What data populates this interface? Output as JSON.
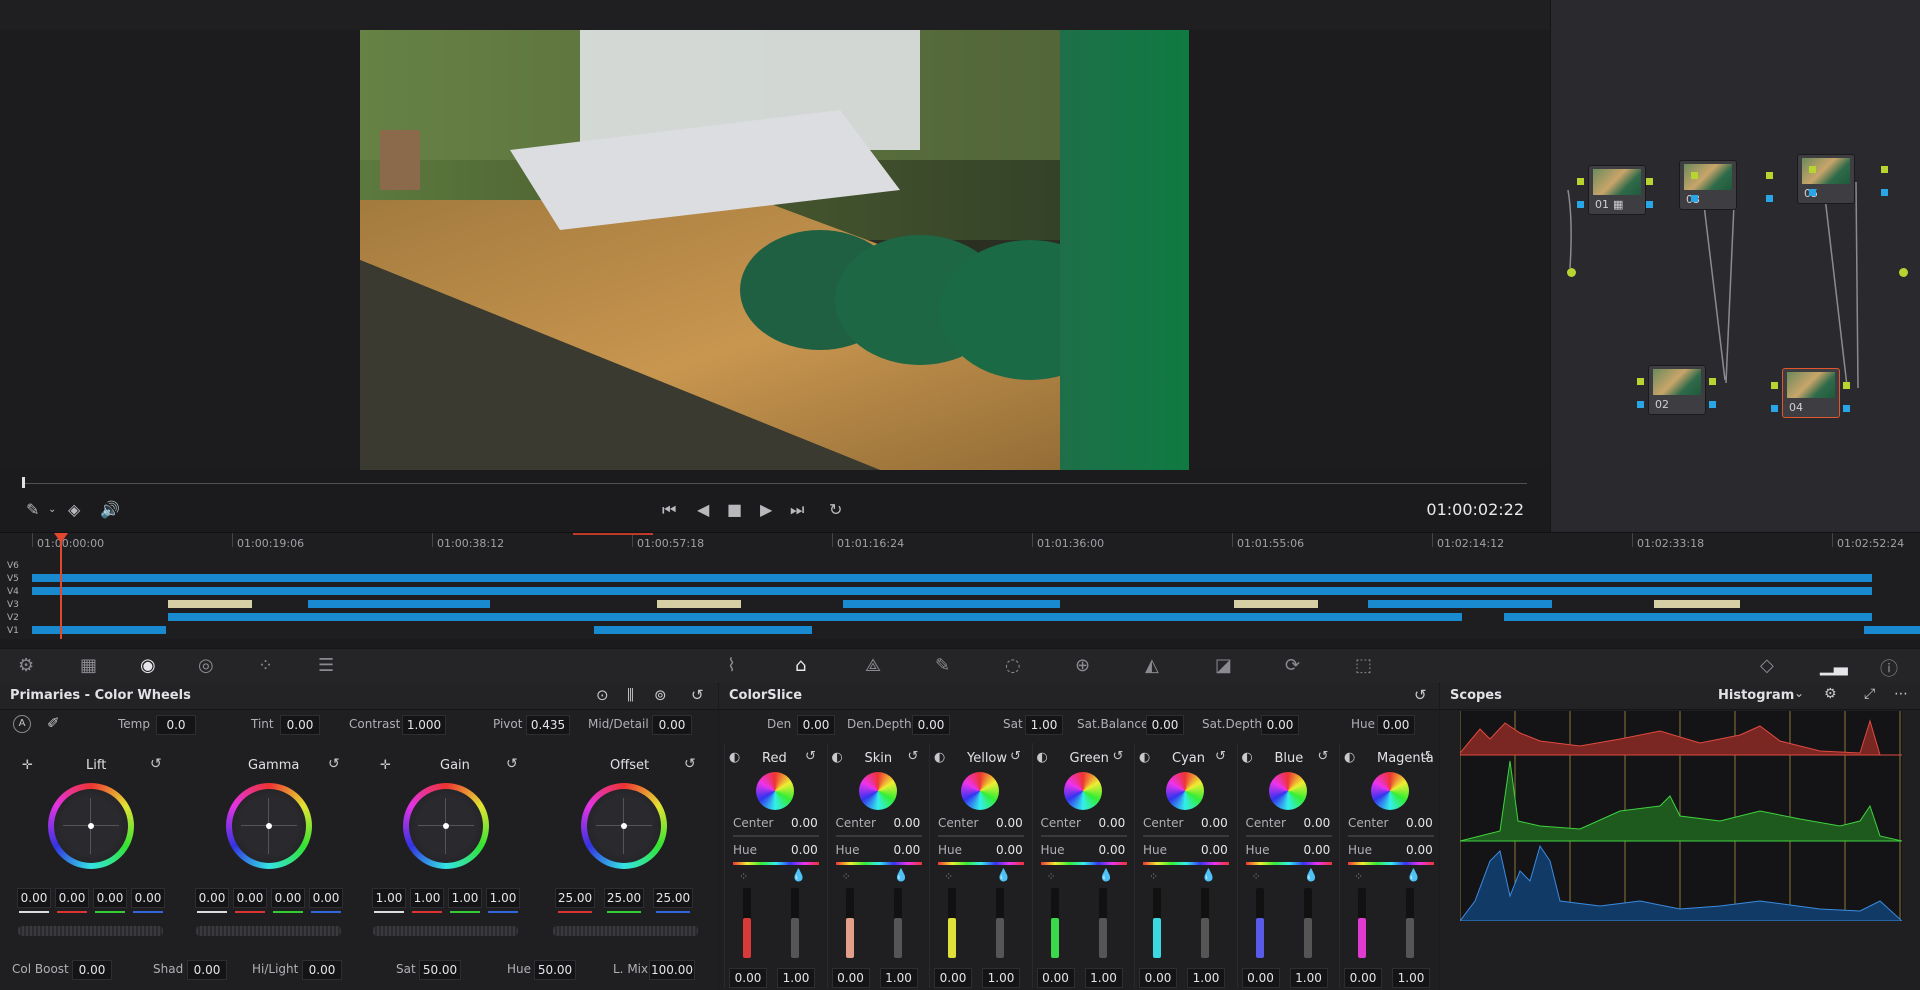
{
  "viewer": {
    "timecode": "01:00:02:22"
  },
  "nodes": [
    {
      "label": "01",
      "has_grid_icon": true
    },
    {
      "label": "02"
    },
    {
      "label": "03"
    },
    {
      "label": "04",
      "selected": true
    },
    {
      "label": "05"
    }
  ],
  "timeline": {
    "timecodes": [
      "01:00:00:00",
      "01:00:19:06",
      "01:00:38:12",
      "01:00:57:18",
      "01:01:16:24",
      "01:01:36:00",
      "01:01:55:06",
      "01:02:14:12",
      "01:02:33:18",
      "01:02:52:24"
    ],
    "tracks": [
      "V6",
      "V5",
      "V4",
      "V3",
      "V2",
      "V1"
    ]
  },
  "primaries": {
    "title": "Primaries - Color Wheels",
    "top_fields": [
      {
        "label": "Temp",
        "value": "0.0"
      },
      {
        "label": "Tint",
        "value": "0.00"
      },
      {
        "label": "Contrast",
        "value": "1.000"
      },
      {
        "label": "Pivot",
        "value": "0.435"
      },
      {
        "label": "Mid/Detail",
        "value": "0.00"
      }
    ],
    "wheels": [
      {
        "name": "Lift",
        "values": [
          "0.00",
          "0.00",
          "0.00",
          "0.00"
        ]
      },
      {
        "name": "Gamma",
        "values": [
          "0.00",
          "0.00",
          "0.00",
          "0.00"
        ]
      },
      {
        "name": "Gain",
        "values": [
          "1.00",
          "1.00",
          "1.00",
          "1.00"
        ]
      },
      {
        "name": "Offset",
        "values": [
          "25.00",
          "25.00",
          "25.00"
        ]
      }
    ],
    "bottom_fields": [
      {
        "label": "Col Boost",
        "value": "0.00"
      },
      {
        "label": "Shad",
        "value": "0.00"
      },
      {
        "label": "Hi/Light",
        "value": "0.00"
      },
      {
        "label": "Sat",
        "value": "50.00"
      },
      {
        "label": "Hue",
        "value": "50.00"
      },
      {
        "label": "L. Mix",
        "value": "100.00"
      }
    ]
  },
  "colorslice": {
    "title": "ColorSlice",
    "top_fields": [
      {
        "label": "Den",
        "value": "0.00"
      },
      {
        "label": "Den.Depth",
        "value": "0.00"
      },
      {
        "label": "Sat",
        "value": "1.00"
      },
      {
        "label": "Sat.Balance",
        "value": "0.00"
      },
      {
        "label": "Sat.Depth",
        "value": "0.00"
      },
      {
        "label": "Hue",
        "value": "0.00"
      }
    ],
    "center_label": "Center",
    "hue_label": "Hue",
    "slices": [
      {
        "name": "Red",
        "center": "0.00",
        "hue": "0.00",
        "v1": "0.00",
        "v2": "1.00",
        "color": "#d83a3a"
      },
      {
        "name": "Skin",
        "center": "0.00",
        "hue": "0.00",
        "v1": "0.00",
        "v2": "1.00",
        "color": "#e2a08a"
      },
      {
        "name": "Yellow",
        "center": "0.00",
        "hue": "0.00",
        "v1": "0.00",
        "v2": "1.00",
        "color": "#e0e03a"
      },
      {
        "name": "Green",
        "center": "0.00",
        "hue": "0.00",
        "v1": "0.00",
        "v2": "1.00",
        "color": "#3ad84a"
      },
      {
        "name": "Cyan",
        "center": "0.00",
        "hue": "0.00",
        "v1": "0.00",
        "v2": "1.00",
        "color": "#3ad8e0"
      },
      {
        "name": "Blue",
        "center": "0.00",
        "hue": "0.00",
        "v1": "0.00",
        "v2": "1.00",
        "color": "#5a5ae8"
      },
      {
        "name": "Magenta",
        "center": "0.00",
        "hue": "0.00",
        "v1": "0.00",
        "v2": "1.00",
        "color": "#e03ad0"
      }
    ]
  },
  "scopes": {
    "title": "Scopes",
    "mode": "Histogram"
  }
}
